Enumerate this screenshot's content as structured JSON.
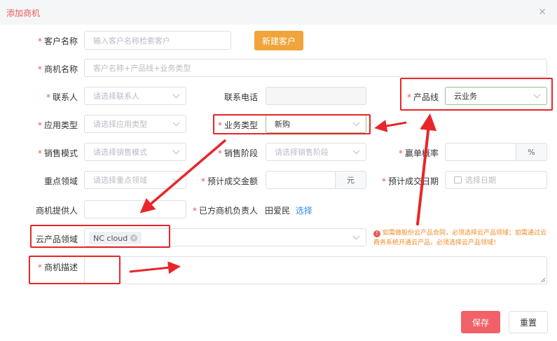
{
  "dialog": {
    "title": "添加商机",
    "close_icon": "close-icon"
  },
  "form": {
    "customer_name": {
      "label": "客户名称",
      "placeholder": "输入客户名称检索客户",
      "new_button": "新建客户"
    },
    "opportunity_name": {
      "label": "商机名称",
      "placeholder": "客户名称+产品线+业务类型"
    },
    "contact": {
      "label": "联系人",
      "placeholder": "请选择联系人"
    },
    "contact_phone": {
      "label": "联系电话",
      "value": ""
    },
    "product_line": {
      "label": "产品线",
      "value": "云业务"
    },
    "application_type": {
      "label": "应用类型",
      "placeholder": "请选择应用类型"
    },
    "business_type": {
      "label": "业务类型",
      "value": "新购"
    },
    "sales_mode": {
      "label": "销售模式",
      "placeholder": "请选择销售模式"
    },
    "sales_stage": {
      "label": "销售阶段",
      "placeholder": "请选择销售阶段"
    },
    "win_rate": {
      "label": "赢单概率",
      "suffix": "%"
    },
    "key_area": {
      "label": "重点领域",
      "placeholder": "请选择重点领域"
    },
    "expected_amount": {
      "label": "预计成交金额",
      "suffix": "元"
    },
    "expected_date": {
      "label": "预计成交日期",
      "placeholder": "选择日期"
    },
    "provider": {
      "label": "商机提供人",
      "value": ""
    },
    "owner": {
      "label": "已方商机负责人",
      "value": "田爱民",
      "select_link": "选择"
    },
    "cloud_domain": {
      "label": "云产品领域",
      "tag": "NC cloud"
    },
    "cloud_note": "如需做股份云产品合同，必须选择云产品领域；如需通过云商务系统开通云产品，必须选择云产品领域！",
    "description": {
      "label": "商机描述",
      "value": ""
    }
  },
  "buttons": {
    "save": "保存",
    "reset": "重置"
  },
  "colors": {
    "accent_orange": "#f0a43a",
    "danger": "#f26168",
    "annotation_red": "#e8262a",
    "required": "#e85a55",
    "link": "#2d8cf0"
  }
}
